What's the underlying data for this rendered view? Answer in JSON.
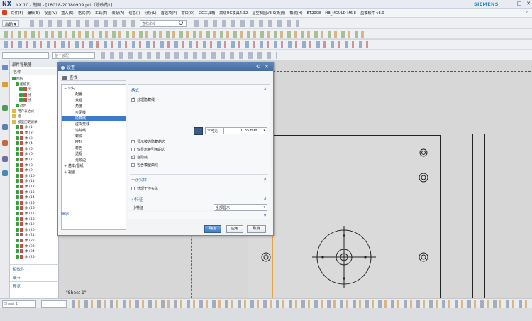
{
  "window": {
    "app_logo": "NX",
    "title": "NX 10 - 制图 - [18018-20180909.prt（修改的）]",
    "brand": "SIEMENS",
    "controls": [
      "–",
      "□",
      "✕"
    ]
  },
  "menubar": {
    "items": [
      "文件(F)",
      "编辑(E)",
      "视图(V)",
      "插入(S)",
      "格式(R)",
      "工具(T)",
      "装配(A)",
      "信息(I)",
      "分析(L)",
      "首选项(P)",
      "窗口(O)",
      "GC工具箱",
      "高级UG模具4.32",
      "星空制图V3.9(免费)",
      "帮助(H)",
      "ET2008",
      "HB_MOULD M6.8",
      "盈模软件 v3.0"
    ],
    "help_hint": "?"
  },
  "toolbar": {
    "start_label": "启动 ▾",
    "command_search_placeholder": "查找命令",
    "filter_placeholder": "整个装配"
  },
  "navigator": {
    "title": "部件导航器",
    "column_name": "名称",
    "rows": [
      {
        "label": "图纸",
        "indent": 0,
        "kind": "check"
      },
      {
        "label": "图纸页",
        "indent": 1,
        "kind": "check"
      },
      {
        "label": "导",
        "indent": 2,
        "kind": "icon"
      },
      {
        "label": "投",
        "indent": 2,
        "kind": "icon"
      },
      {
        "label": "投",
        "indent": 2,
        "kind": "icon"
      },
      {
        "label": "过时",
        "indent": 1,
        "kind": "check"
      },
      {
        "label": "用户表达式",
        "indent": 0,
        "kind": "fold"
      },
      {
        "label": "组",
        "indent": 0,
        "kind": "fold"
      },
      {
        "label": "模型历史记录",
        "indent": 0,
        "kind": "fold"
      },
      {
        "label": "体 (1)",
        "indent": 1,
        "kind": "icon"
      },
      {
        "label": "体 (2)",
        "indent": 1,
        "kind": "icon"
      },
      {
        "label": "体 (3)",
        "indent": 1,
        "kind": "icon"
      },
      {
        "label": "体 (4)",
        "indent": 1,
        "kind": "icon"
      },
      {
        "label": "体 (5)",
        "indent": 1,
        "kind": "icon"
      },
      {
        "label": "体 (6)",
        "indent": 1,
        "kind": "icon"
      },
      {
        "label": "体 (7)",
        "indent": 1,
        "kind": "icon"
      },
      {
        "label": "体 (8)",
        "indent": 1,
        "kind": "icon"
      },
      {
        "label": "体 (9)",
        "indent": 1,
        "kind": "icon"
      },
      {
        "label": "体 (10)",
        "indent": 1,
        "kind": "icon"
      },
      {
        "label": "体 (11)",
        "indent": 1,
        "kind": "icon"
      },
      {
        "label": "体 (12)",
        "indent": 1,
        "kind": "icon"
      },
      {
        "label": "体 (13)",
        "indent": 1,
        "kind": "icon"
      },
      {
        "label": "体 (14)",
        "indent": 1,
        "kind": "icon"
      },
      {
        "label": "体 (15)",
        "indent": 1,
        "kind": "icon"
      },
      {
        "label": "体 (16)",
        "indent": 1,
        "kind": "icon"
      },
      {
        "label": "体 (17)",
        "indent": 1,
        "kind": "icon"
      },
      {
        "label": "体 (18)",
        "indent": 1,
        "kind": "icon"
      },
      {
        "label": "体 (19)",
        "indent": 1,
        "kind": "icon"
      },
      {
        "label": "体 (20)",
        "indent": 1,
        "kind": "icon"
      },
      {
        "label": "体 (21)",
        "indent": 1,
        "kind": "icon"
      },
      {
        "label": "体 (22)",
        "indent": 1,
        "kind": "icon"
      },
      {
        "label": "体 (23)",
        "indent": 1,
        "kind": "icon"
      },
      {
        "label": "体 (24)",
        "indent": 1,
        "kind": "icon"
      },
      {
        "label": "体 (25)",
        "indent": 1,
        "kind": "icon"
      }
    ],
    "bottom_tabs": [
      "相依性",
      "细节",
      "预览"
    ]
  },
  "dialog": {
    "title": "设置",
    "find_label": "查找",
    "tree": [
      {
        "label": "公共",
        "pm": "−",
        "indent": 0,
        "selected": false
      },
      {
        "label": "配置",
        "pm": "",
        "indent": 1,
        "selected": false
      },
      {
        "label": "常规",
        "pm": "",
        "indent": 1,
        "selected": false
      },
      {
        "label": "角度",
        "pm": "",
        "indent": 1,
        "selected": false
      },
      {
        "label": "可见线",
        "pm": "",
        "indent": 1,
        "selected": false
      },
      {
        "label": "隐藏线",
        "pm": "",
        "indent": 1,
        "selected": true
      },
      {
        "label": "虚拟交线",
        "pm": "",
        "indent": 1,
        "selected": false
      },
      {
        "label": "追踪线",
        "pm": "",
        "indent": 1,
        "selected": false
      },
      {
        "label": "螺纹",
        "pm": "",
        "indent": 1,
        "selected": false
      },
      {
        "label": "PMI",
        "pm": "",
        "indent": 1,
        "selected": false
      },
      {
        "label": "着色",
        "pm": "",
        "indent": 1,
        "selected": false
      },
      {
        "label": "透视",
        "pm": "",
        "indent": 1,
        "selected": false
      },
      {
        "label": "光顺边",
        "pm": "",
        "indent": 1,
        "selected": false
      },
      {
        "label": "基本/图纸",
        "pm": "+",
        "indent": 0,
        "selected": false
      },
      {
        "label": "视图",
        "pm": "+",
        "indent": 0,
        "selected": false
      }
    ],
    "sections": {
      "format": {
        "title": "格式",
        "process_hidden": "处理隐藏线",
        "line_type": "不可见",
        "line_width": "0.35 mm",
        "options": [
          {
            "label": "显示被边隐藏的边",
            "checked": false
          },
          {
            "label": "仅显示被引用的边",
            "checked": false
          },
          {
            "label": "自隐藏",
            "checked": true
          },
          {
            "label": "包含模型曲线",
            "checked": false
          }
        ]
      },
      "interference": {
        "title": "干涉实体",
        "process": "处理干涉实体"
      },
      "small_feature": {
        "title": "小特征",
        "label": "小特征",
        "value": "全部显示"
      }
    },
    "inherit_label": "继承",
    "buttons": {
      "ok": "确定",
      "apply": "应用",
      "cancel": "取消"
    },
    "colors": {
      "title_bar": "#456c9f",
      "line_color": "#3b5c84",
      "selected_row": "#3d79cc"
    }
  },
  "canvas": {
    "sheet_label": "\"Sheet 1\""
  },
  "statusbar": {
    "sheet_selector": "Sheet 1"
  }
}
